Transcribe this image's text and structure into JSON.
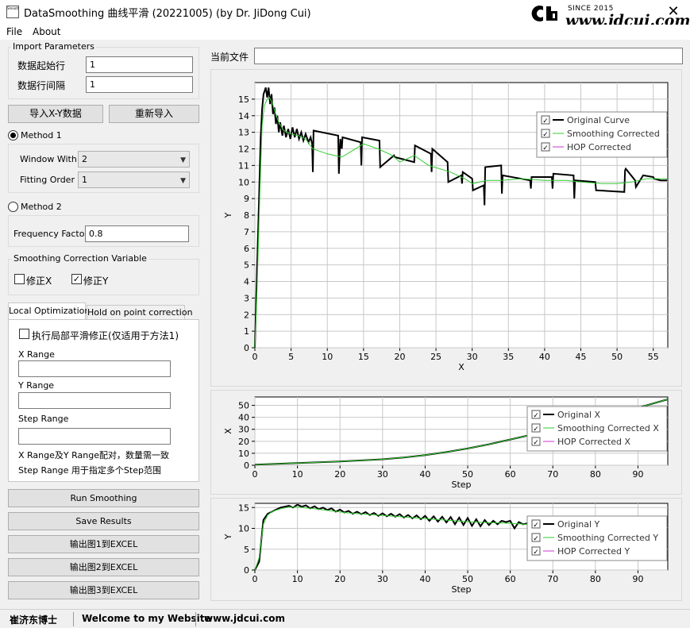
{
  "window": {
    "title": "DataSmoothing 曲线平滑 (20221005) (by Dr. JiDong Cui)",
    "app_icon_text": "Smooth",
    "close_symbol": "✕",
    "brand_since": "SINCE 2015",
    "brand_url": "www.jdcui.com"
  },
  "menu": {
    "file": "File",
    "about": "About"
  },
  "import": {
    "title": "Import Parameters",
    "start_row_label": "数据起始行",
    "start_row_value": "1",
    "row_interval_label": "数据行间隔",
    "row_interval_value": "1",
    "import_xy_button": "导入X-Y数据",
    "reimport_button": "重新导入"
  },
  "method1": {
    "label": "Method 1",
    "selected": true,
    "window_label": "Window With",
    "window_value": "2",
    "order_label": "Fitting Order",
    "order_value": "1"
  },
  "method2": {
    "label": "Method 2",
    "selected": false,
    "freq_label": "Frequency Factor",
    "freq_value": "0.8"
  },
  "correction": {
    "title": "Smoothing Correction Variable",
    "fix_x_label": "修正X",
    "fix_x_checked": false,
    "fix_y_label": "修正Y",
    "fix_y_checked": true
  },
  "tabs": {
    "local": "Local Optimization",
    "hold": "Hold on point correction"
  },
  "local_opt": {
    "exec_label": "执行局部平滑修正(仅适用于方法1)",
    "exec_checked": false,
    "x_range_label": "X Range",
    "x_range_value": "",
    "y_range_label": "Y Range",
    "y_range_value": "",
    "step_range_label": "Step Range",
    "step_range_value": "",
    "note1": "X Range及Y Range配对，数量需一致",
    "note2": "Step Range 用于指定多个Step范围"
  },
  "buttons": {
    "run": "Run Smoothing",
    "save": "Save Results",
    "export1": "输出图1到EXCEL",
    "export2": "输出图2到EXCEL",
    "export3": "输出图3到EXCEL"
  },
  "current_file": {
    "label": "当前文件",
    "value": ""
  },
  "status": {
    "author": "崔济东博士",
    "welcome": "Welcome to my Website",
    "site": "www.jdcui.com"
  },
  "colors": {
    "original": "#000000",
    "smoothing": "#32cd32",
    "hop": "#cc33cc",
    "plot_bg": "#ffffff",
    "grid": "#c8c8c8"
  },
  "chart_data": [
    {
      "type": "line",
      "xlabel": "X",
      "ylabel": "Y",
      "xlim": [
        0,
        57
      ],
      "ylim": [
        0,
        16
      ],
      "xticks": [
        0,
        5,
        10,
        15,
        20,
        25,
        30,
        35,
        40,
        45,
        50,
        55
      ],
      "yticks": [
        0,
        1,
        2,
        3,
        4,
        5,
        6,
        7,
        8,
        9,
        10,
        11,
        12,
        13,
        14,
        15
      ],
      "grid": true,
      "legend_position": "top-right",
      "series": [
        {
          "name": "Original Curve",
          "x": [
            0,
            0.2,
            0.5,
            0.8,
            1.0,
            1.2,
            1.5,
            1.7,
            1.9,
            2.1,
            2.3,
            2.5,
            2.7,
            2.9,
            3.1,
            3.3,
            3.5,
            3.8,
            4.0,
            4.3,
            4.6,
            4.9,
            5.2,
            5.5,
            5.8,
            6.1,
            6.4,
            6.7,
            7.0,
            7.4,
            7.7,
            7.9,
            8.0,
            8.1,
            11.5,
            11.6,
            11.7,
            11.8,
            12.0,
            12.1,
            14.6,
            14.7,
            14.8,
            17.2,
            17.3,
            19.2,
            19.3,
            22.0,
            22.1,
            24.3,
            24.4,
            24.5,
            26.6,
            26.7,
            28.5,
            28.6,
            28.7,
            30.0,
            30.1,
            31.6,
            31.7,
            31.8,
            34.0,
            34.1,
            34.2,
            38.0,
            38.1,
            38.2,
            41.0,
            41.1,
            41.2,
            44.0,
            44.1,
            44.2,
            47.0,
            47.1,
            51.0,
            51.1,
            51.2,
            52.5,
            52.6,
            53.6,
            55.0,
            55.1,
            56.0,
            56.9
          ],
          "y": [
            0,
            3.2,
            7.9,
            12.7,
            14.4,
            15.3,
            15.7,
            15.1,
            15.7,
            14.7,
            15.3,
            14.1,
            14.5,
            13.5,
            14.0,
            13.0,
            13.6,
            12.8,
            13.4,
            12.7,
            13.2,
            12.6,
            13.3,
            12.7,
            13.2,
            12.6,
            13.0,
            12.5,
            12.9,
            12.4,
            12.7,
            12.3,
            10.6,
            13.1,
            12.8,
            10.5,
            11.6,
            12.6,
            12.0,
            12.7,
            12.4,
            11.0,
            12.7,
            12.5,
            10.9,
            11.6,
            11.5,
            11.2,
            12.2,
            11.7,
            10.6,
            12.0,
            11.2,
            10.0,
            10.4,
            9.9,
            10.6,
            10.2,
            9.5,
            9.8,
            8.6,
            10.9,
            11.0,
            9.3,
            10.4,
            10.1,
            9.6,
            10.3,
            10.3,
            9.6,
            10.5,
            10.4,
            9.0,
            10.1,
            10.0,
            9.5,
            9.4,
            10.7,
            10.8,
            10.1,
            9.7,
            10.4,
            10.3,
            10.2,
            10.1,
            10.1
          ]
        },
        {
          "name": "Smoothing Corrected",
          "x": [
            0,
            0.3,
            0.7,
            1.0,
            1.3,
            1.7,
            2.0,
            2.4,
            2.8,
            3.3,
            4.0,
            5.0,
            6.0,
            7.0,
            8.0,
            10.0,
            12.0,
            13.5,
            15.0,
            17.0,
            19.0,
            20.0,
            21.0,
            22.0,
            24.0,
            27.0,
            29.0,
            30.0,
            32.0,
            34.0,
            37.0,
            40.0,
            43.0,
            45.0,
            48.0,
            50.0,
            52.0,
            54.0,
            56.9
          ],
          "y": [
            0,
            3.4,
            9.5,
            13.4,
            14.6,
            15.0,
            15.1,
            14.8,
            14.2,
            13.6,
            13.1,
            12.9,
            12.8,
            12.6,
            12.0,
            11.7,
            11.5,
            11.9,
            12.3,
            12.0,
            11.6,
            11.2,
            11.4,
            11.6,
            11.0,
            10.6,
            10.2,
            9.9,
            10.1,
            10.1,
            10.2,
            10.1,
            10.1,
            10.0,
            9.9,
            9.9,
            10.0,
            10.2,
            10.2
          ]
        },
        {
          "name": "HOP Corrected",
          "x": [],
          "y": []
        }
      ]
    },
    {
      "type": "line",
      "xlabel": "Step",
      "ylabel": "X",
      "xlim": [
        0,
        97
      ],
      "ylim": [
        0,
        57
      ],
      "xticks": [
        0,
        10,
        20,
        30,
        40,
        50,
        60,
        70,
        80,
        90
      ],
      "yticks": [
        0,
        10,
        20,
        30,
        40,
        50
      ],
      "grid": true,
      "legend_position": "right",
      "series": [
        {
          "name": "Original X",
          "x": [
            0,
            10,
            20,
            30,
            35,
            40,
            45,
            50,
            55,
            60,
            65,
            70,
            75,
            80,
            85,
            90,
            95,
            97
          ],
          "y": [
            0.5,
            1.8,
            3.2,
            5.0,
            6.5,
            8.5,
            11.0,
            14.0,
            17.5,
            21.5,
            25.5,
            30.0,
            34.5,
            39.0,
            43.5,
            48.0,
            53.0,
            55.0
          ]
        },
        {
          "name": "Smoothing Corrected X",
          "x": [
            0,
            10,
            20,
            30,
            35,
            40,
            45,
            50,
            55,
            60,
            65,
            70,
            75,
            80,
            85,
            90,
            95,
            97
          ],
          "y": [
            0.5,
            1.8,
            3.2,
            5.0,
            6.5,
            8.5,
            11.0,
            14.0,
            17.5,
            21.5,
            25.5,
            30.0,
            34.5,
            39.0,
            43.5,
            48.0,
            53.0,
            55.0
          ]
        },
        {
          "name": "HOP Corrected X",
          "x": [],
          "y": []
        }
      ]
    },
    {
      "type": "line",
      "xlabel": "Step",
      "ylabel": "Y",
      "xlim": [
        0,
        97
      ],
      "ylim": [
        0,
        16
      ],
      "xticks": [
        0,
        10,
        20,
        30,
        40,
        50,
        60,
        70,
        80,
        90
      ],
      "yticks": [
        0,
        5,
        10,
        15
      ],
      "grid": true,
      "legend_position": "right",
      "series": [
        {
          "name": "Original Y",
          "x": [
            0,
            1,
            2,
            3,
            4,
            5,
            6,
            7,
            8,
            9,
            10,
            11,
            12,
            13,
            14,
            15,
            16,
            17,
            18,
            19,
            20,
            21,
            22,
            23,
            24,
            25,
            26,
            27,
            28,
            29,
            30,
            31,
            32,
            33,
            34,
            35,
            36,
            37,
            38,
            39,
            40,
            41,
            42,
            43,
            44,
            45,
            46,
            47,
            48,
            49,
            50,
            51,
            52,
            53,
            54,
            55,
            56,
            57,
            58,
            59,
            60,
            61,
            62,
            63,
            64,
            65,
            66,
            67,
            68,
            69,
            70,
            72,
            74,
            76,
            78,
            80,
            82,
            84,
            86,
            88,
            90,
            92,
            94,
            96,
            97
          ],
          "y": [
            0,
            2,
            12,
            13.5,
            14,
            14.5,
            15,
            15.2,
            15.4,
            15.0,
            15.7,
            15.2,
            15.5,
            14.8,
            15.3,
            14.6,
            15.0,
            14.4,
            14.8,
            14.0,
            14.5,
            13.8,
            14.2,
            13.5,
            14.0,
            13.4,
            13.9,
            13.2,
            13.7,
            13.0,
            13.6,
            12.9,
            13.5,
            12.8,
            13.4,
            12.6,
            13.2,
            12.4,
            13.1,
            12.2,
            13.0,
            11.8,
            12.9,
            11.6,
            12.8,
            11.4,
            12.7,
            11.0,
            12.6,
            10.8,
            12.5,
            10.6,
            12.2,
            10.5,
            12.0,
            10.8,
            11.8,
            11.0,
            11.8,
            11.5,
            11.8,
            10.0,
            11.5,
            11.0,
            11.2,
            10.6,
            10.4,
            10.2,
            10.3,
            9.6,
            10.0,
            10.3,
            9.4,
            10.4,
            9.8,
            9.7,
            9.5,
            9.6,
            10.2,
            10.8,
            11.0,
            10.4,
            10.2,
            10.1,
            10.1
          ]
        },
        {
          "name": "Smoothing Corrected Y",
          "x": [
            0,
            1,
            2,
            3,
            4,
            6,
            8,
            10,
            14,
            18,
            22,
            26,
            30,
            34,
            38,
            42,
            46,
            50,
            54,
            58,
            62,
            66,
            70,
            74,
            78,
            82,
            86,
            90,
            94,
            97
          ],
          "y": [
            0,
            3,
            11,
            13.2,
            14,
            14.7,
            15.1,
            15.1,
            14.7,
            14.2,
            13.7,
            13.4,
            13.1,
            12.8,
            12.5,
            12.2,
            11.9,
            11.6,
            11.4,
            11.3,
            11.1,
            10.8,
            10.5,
            10.3,
            10.2,
            10.1,
            10.2,
            10.4,
            10.3,
            10.2
          ]
        },
        {
          "name": "HOP Corrected Y",
          "x": [],
          "y": []
        }
      ]
    }
  ]
}
